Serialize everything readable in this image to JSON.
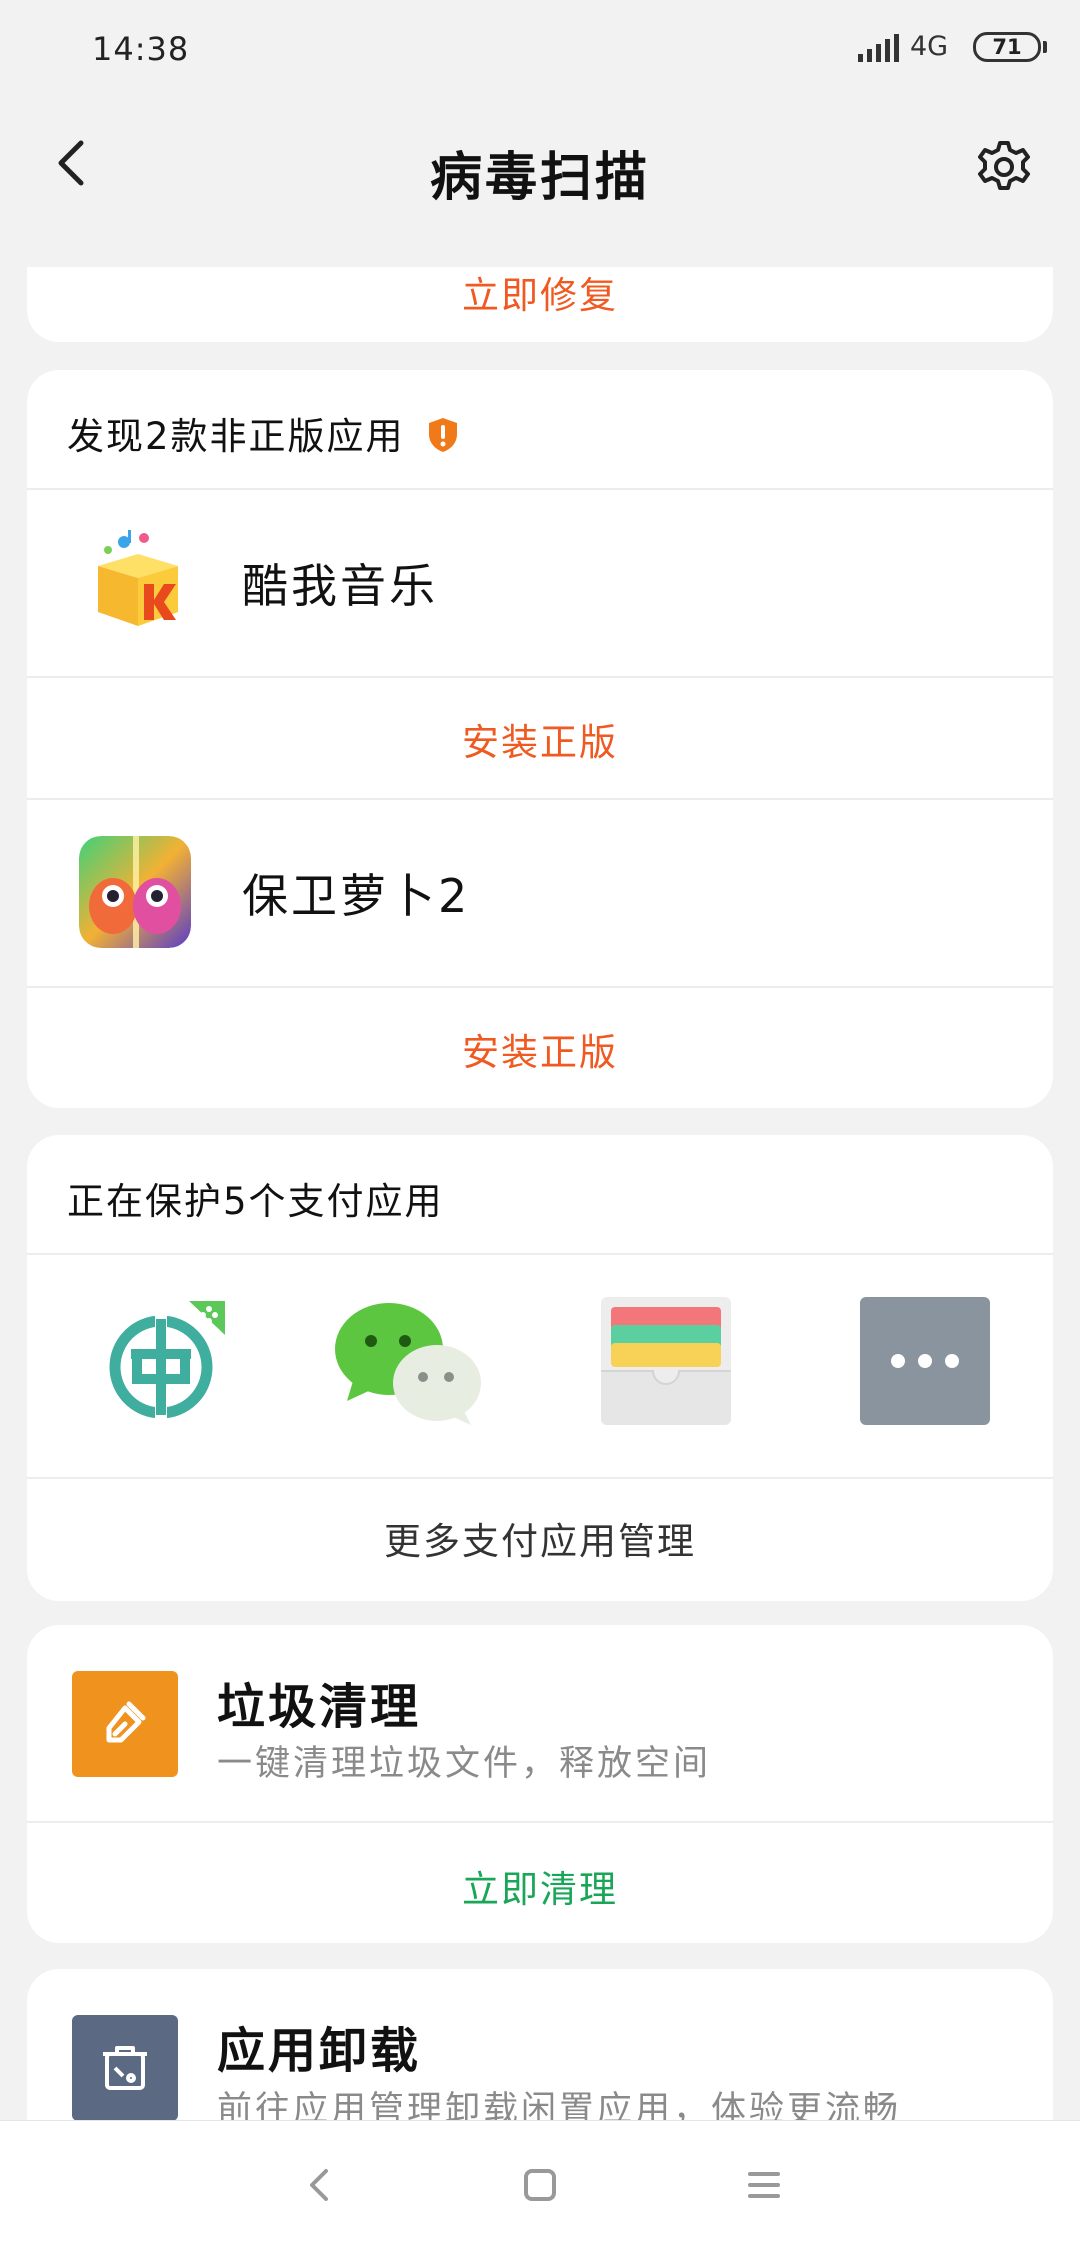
{
  "status_bar": {
    "time": "14:38",
    "network": "4G",
    "battery": "71"
  },
  "header": {
    "title": "病毒扫描",
    "back_icon": "chevron-left-icon",
    "settings_icon": "gear-icon"
  },
  "repair_card": {
    "action": "立即修复"
  },
  "pirate_card": {
    "title": "发现2款非正版应用",
    "warning_icon": "shield-alert-icon",
    "apps": [
      {
        "name": "酷我音乐",
        "action": "安装正版"
      },
      {
        "name": "保卫萝卜2",
        "action": "安装正版"
      }
    ]
  },
  "payment_card": {
    "title": "正在保护5个支付应用",
    "apps": [
      "bank-app-icon",
      "wechat-icon",
      "wallet-icon",
      "more-icon"
    ],
    "manage_label": "更多支付应用管理"
  },
  "cleanup_card": {
    "title": "垃圾清理",
    "desc": "一键清理垃圾文件，释放空间",
    "action": "立即清理"
  },
  "uninstall_card": {
    "title": "应用卸载",
    "desc": "前往应用管理卸载闲置应用，体验更流畅"
  },
  "colors": {
    "accent_orange": "#f05a22",
    "accent_green": "#1aa657",
    "background": "#f2f2f2"
  }
}
